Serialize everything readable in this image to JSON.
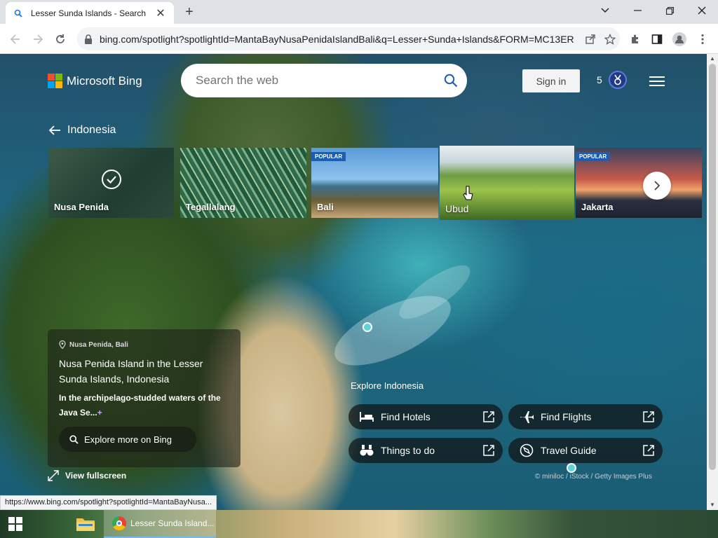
{
  "browser": {
    "tab_title": "Lesser Sunda Islands - Search",
    "url": "bing.com/spotlight?spotlightId=MantaBayNusaPenidaIslandBali&q=Lesser+Sunda+Islands&FORM=MC13ER",
    "status_url": "https://www.bing.com/spotlight?spotlightId=MantaBayNusa..."
  },
  "header": {
    "logo_text": "Microsoft Bing",
    "search_placeholder": "Search the web",
    "sign_in": "Sign in",
    "rewards_count": "5"
  },
  "nav": {
    "back_label": "Indonesia"
  },
  "carousel": {
    "cards": [
      {
        "label": "Nusa Penida",
        "badge": "",
        "selected": true
      },
      {
        "label": "Tegallalang",
        "badge": ""
      },
      {
        "label": "Bali",
        "badge": "POPULAR"
      },
      {
        "label": "Ubud",
        "badge": ""
      },
      {
        "label": "Jakarta",
        "badge": "POPULAR"
      }
    ]
  },
  "info": {
    "location": "Nusa Penida, Bali",
    "title": "Nusa Penida Island in the Lesser Sunda Islands, Indonesia",
    "description": "In the archipelago-studded waters of the Java Se...",
    "explore_button": "Explore more on Bing",
    "fullscreen": "View fullscreen"
  },
  "explore": {
    "title": "Explore Indonesia",
    "actions": {
      "hotels": "Find Hotels",
      "flights": "Find Flights",
      "things": "Things to do",
      "guide": "Travel Guide"
    }
  },
  "credit": "© miniloc / iStock / Getty Images Plus",
  "taskbar": {
    "chrome_label": "Lesser Sunda Island..."
  },
  "colors": {
    "bing_accent": "#1a5fb4",
    "hotspot": "#5fd4d8"
  }
}
